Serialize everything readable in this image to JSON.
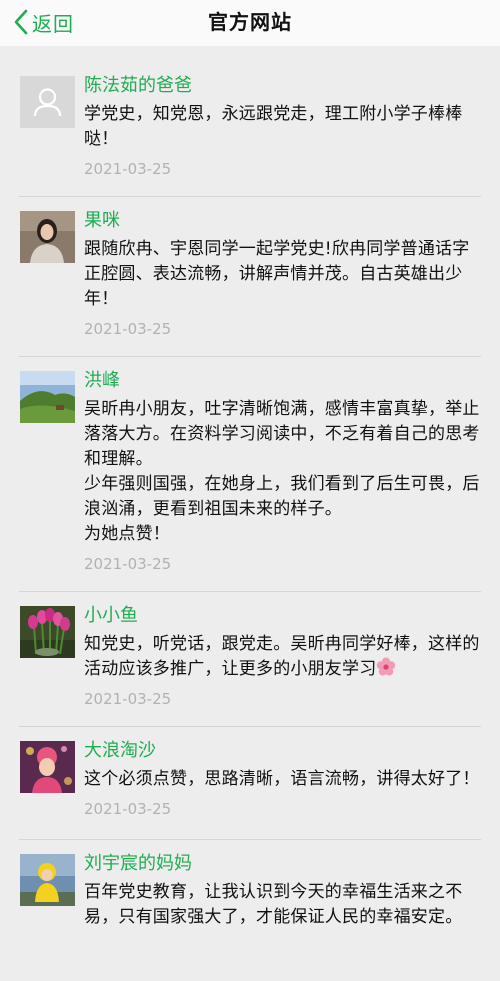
{
  "header": {
    "back_label": "返回",
    "title": "官方网站"
  },
  "colors": {
    "accent": "#1fad52",
    "date": "#b2b2b2",
    "background": "#ededed"
  },
  "comments": [
    {
      "name": "陈法茹的爸爸",
      "avatar": "default-user-icon",
      "text": "学党史，知党恩，永远跟党走，理工附小学子棒棒哒！",
      "date": "2021-03-25"
    },
    {
      "name": "果咪",
      "avatar": "woman-photo",
      "text": "跟随欣冉、宇恩同学一起学党史!欣冉同学普通话字正腔圆、表达流畅，讲解声情并茂。自古英雄出少年！",
      "date": "2021-03-25"
    },
    {
      "name": "洪峰",
      "avatar": "landscape-photo",
      "text": "吴昕冉小朋友，吐字清晰饱满，感情丰富真挚，举止落落大方。在资料学习阅读中，不乏有着自己的思考和理解。\n少年强则国强，在她身上，我们看到了后生可畏，后浪汹涌，更看到祖国未来的样子。\n为她点赞！",
      "date": "2021-03-25"
    },
    {
      "name": "小小鱼",
      "avatar": "tulips-photo",
      "text": "知党史，听党话，跟党走。吴昕冉同学好棒，这样的活动应该多推广，让更多的小朋友学习",
      "emoji": "hibiscus-emoji",
      "date": "2021-03-25"
    },
    {
      "name": "大浪淘沙",
      "avatar": "child-photo",
      "text": "这个必须点赞，思路清晰，语言流畅，讲得太好了！",
      "date": "2021-03-25"
    },
    {
      "name": "刘宇宸的妈妈",
      "avatar": "kid-yellow-photo",
      "text": "百年党史教育，让我认识到今天的幸福生活来之不易，只有国家强大了，才能保证人民的幸福安定。",
      "date": ""
    }
  ]
}
